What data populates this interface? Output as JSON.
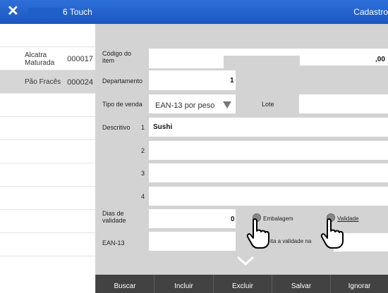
{
  "window": {
    "close_glyph": "✕",
    "title": "6 Touch",
    "module": "Cadastro"
  },
  "products": [
    {
      "name": "Alcatra Maturada",
      "code": "000017"
    },
    {
      "name": "Pão Fracês",
      "code": "000024"
    }
  ],
  "form": {
    "codigo_label": "Código do item",
    "codigo_value": ",00",
    "departamento_label": "Departamento",
    "departamento_value": "1",
    "tipo_venda_label": "Tipo de venda",
    "tipo_venda_value": "EAN-13 por peso",
    "lote_label": "Lote",
    "descritivo_label": "Descritivo",
    "descritivo_lines": [
      {
        "n": "1",
        "text": "Sushi"
      },
      {
        "n": "2",
        "text": ""
      },
      {
        "n": "3",
        "text": ""
      },
      {
        "n": "4",
        "text": ""
      }
    ],
    "dias_validade_label": "Dias de validade",
    "dias_validade_value": "0",
    "embalagem_label": "Embalagem",
    "validade_label": "Validade",
    "ean_label": "EAN-13",
    "ean_hint": "ita a validade na"
  },
  "buttons": {
    "buscar": "Buscar",
    "incluir": "Incluir",
    "excluir": "Excluir",
    "salvar": "Salvar",
    "ignorar": "Ignorar"
  },
  "colors": {
    "titlebar": "#1f5fc8",
    "panel": "#d3d3d3",
    "button": "#424242",
    "selected_row": "#d6d6d6"
  },
  "icons": [
    "close-icon",
    "dropdown-arrow-icon",
    "pointer-hand-icon",
    "chevron-down-icon"
  ]
}
